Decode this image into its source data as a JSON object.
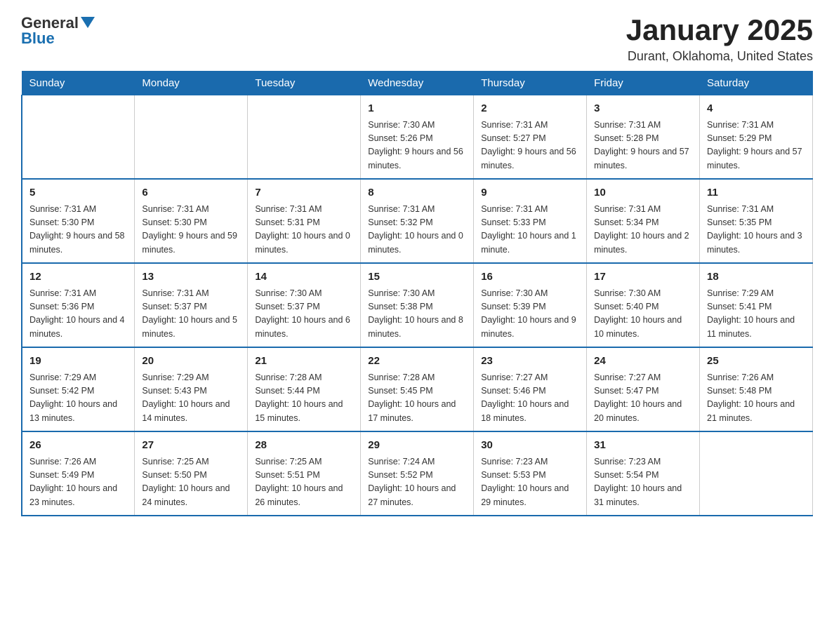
{
  "logo": {
    "general": "General",
    "blue": "Blue"
  },
  "header": {
    "title": "January 2025",
    "subtitle": "Durant, Oklahoma, United States"
  },
  "weekdays": [
    "Sunday",
    "Monday",
    "Tuesday",
    "Wednesday",
    "Thursday",
    "Friday",
    "Saturday"
  ],
  "weeks": [
    [
      {
        "day": "",
        "info": ""
      },
      {
        "day": "",
        "info": ""
      },
      {
        "day": "",
        "info": ""
      },
      {
        "day": "1",
        "info": "Sunrise: 7:30 AM\nSunset: 5:26 PM\nDaylight: 9 hours and 56 minutes."
      },
      {
        "day": "2",
        "info": "Sunrise: 7:31 AM\nSunset: 5:27 PM\nDaylight: 9 hours and 56 minutes."
      },
      {
        "day": "3",
        "info": "Sunrise: 7:31 AM\nSunset: 5:28 PM\nDaylight: 9 hours and 57 minutes."
      },
      {
        "day": "4",
        "info": "Sunrise: 7:31 AM\nSunset: 5:29 PM\nDaylight: 9 hours and 57 minutes."
      }
    ],
    [
      {
        "day": "5",
        "info": "Sunrise: 7:31 AM\nSunset: 5:30 PM\nDaylight: 9 hours and 58 minutes."
      },
      {
        "day": "6",
        "info": "Sunrise: 7:31 AM\nSunset: 5:30 PM\nDaylight: 9 hours and 59 minutes."
      },
      {
        "day": "7",
        "info": "Sunrise: 7:31 AM\nSunset: 5:31 PM\nDaylight: 10 hours and 0 minutes."
      },
      {
        "day": "8",
        "info": "Sunrise: 7:31 AM\nSunset: 5:32 PM\nDaylight: 10 hours and 0 minutes."
      },
      {
        "day": "9",
        "info": "Sunrise: 7:31 AM\nSunset: 5:33 PM\nDaylight: 10 hours and 1 minute."
      },
      {
        "day": "10",
        "info": "Sunrise: 7:31 AM\nSunset: 5:34 PM\nDaylight: 10 hours and 2 minutes."
      },
      {
        "day": "11",
        "info": "Sunrise: 7:31 AM\nSunset: 5:35 PM\nDaylight: 10 hours and 3 minutes."
      }
    ],
    [
      {
        "day": "12",
        "info": "Sunrise: 7:31 AM\nSunset: 5:36 PM\nDaylight: 10 hours and 4 minutes."
      },
      {
        "day": "13",
        "info": "Sunrise: 7:31 AM\nSunset: 5:37 PM\nDaylight: 10 hours and 5 minutes."
      },
      {
        "day": "14",
        "info": "Sunrise: 7:30 AM\nSunset: 5:37 PM\nDaylight: 10 hours and 6 minutes."
      },
      {
        "day": "15",
        "info": "Sunrise: 7:30 AM\nSunset: 5:38 PM\nDaylight: 10 hours and 8 minutes."
      },
      {
        "day": "16",
        "info": "Sunrise: 7:30 AM\nSunset: 5:39 PM\nDaylight: 10 hours and 9 minutes."
      },
      {
        "day": "17",
        "info": "Sunrise: 7:30 AM\nSunset: 5:40 PM\nDaylight: 10 hours and 10 minutes."
      },
      {
        "day": "18",
        "info": "Sunrise: 7:29 AM\nSunset: 5:41 PM\nDaylight: 10 hours and 11 minutes."
      }
    ],
    [
      {
        "day": "19",
        "info": "Sunrise: 7:29 AM\nSunset: 5:42 PM\nDaylight: 10 hours and 13 minutes."
      },
      {
        "day": "20",
        "info": "Sunrise: 7:29 AM\nSunset: 5:43 PM\nDaylight: 10 hours and 14 minutes."
      },
      {
        "day": "21",
        "info": "Sunrise: 7:28 AM\nSunset: 5:44 PM\nDaylight: 10 hours and 15 minutes."
      },
      {
        "day": "22",
        "info": "Sunrise: 7:28 AM\nSunset: 5:45 PM\nDaylight: 10 hours and 17 minutes."
      },
      {
        "day": "23",
        "info": "Sunrise: 7:27 AM\nSunset: 5:46 PM\nDaylight: 10 hours and 18 minutes."
      },
      {
        "day": "24",
        "info": "Sunrise: 7:27 AM\nSunset: 5:47 PM\nDaylight: 10 hours and 20 minutes."
      },
      {
        "day": "25",
        "info": "Sunrise: 7:26 AM\nSunset: 5:48 PM\nDaylight: 10 hours and 21 minutes."
      }
    ],
    [
      {
        "day": "26",
        "info": "Sunrise: 7:26 AM\nSunset: 5:49 PM\nDaylight: 10 hours and 23 minutes."
      },
      {
        "day": "27",
        "info": "Sunrise: 7:25 AM\nSunset: 5:50 PM\nDaylight: 10 hours and 24 minutes."
      },
      {
        "day": "28",
        "info": "Sunrise: 7:25 AM\nSunset: 5:51 PM\nDaylight: 10 hours and 26 minutes."
      },
      {
        "day": "29",
        "info": "Sunrise: 7:24 AM\nSunset: 5:52 PM\nDaylight: 10 hours and 27 minutes."
      },
      {
        "day": "30",
        "info": "Sunrise: 7:23 AM\nSunset: 5:53 PM\nDaylight: 10 hours and 29 minutes."
      },
      {
        "day": "31",
        "info": "Sunrise: 7:23 AM\nSunset: 5:54 PM\nDaylight: 10 hours and 31 minutes."
      },
      {
        "day": "",
        "info": ""
      }
    ]
  ]
}
